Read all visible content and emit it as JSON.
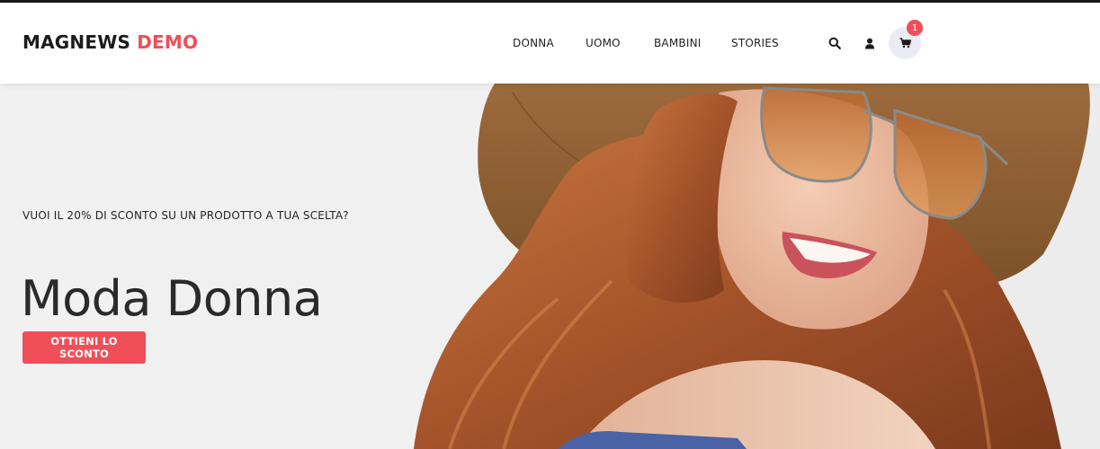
{
  "header": {
    "logo": {
      "primary": "MAGNEWS",
      "accent": "DEMO"
    },
    "nav": [
      "DONNA",
      "UOMO",
      "BAMBINI",
      "STORIES"
    ],
    "icons": {
      "search": "search-icon",
      "account": "user-icon",
      "cart": "cart-icon"
    },
    "cart_count": "1"
  },
  "hero": {
    "subtitle": "VUOI IL 20% DI SCONTO SU UN PRODOTTO A TUA SCELTA?",
    "title": "Moda Donna",
    "cta_label": "OTTIENI LO SCONTO",
    "image": "woman-wearing-straw-hat-and-sunglasses"
  },
  "colors": {
    "accent": "#f04e58",
    "text": "#1b1b1b",
    "hero_bg": "#efefef"
  }
}
